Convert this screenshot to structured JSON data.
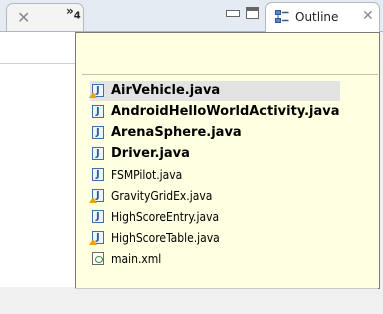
{
  "header": {
    "overflow_chevron": "»",
    "overflow_count": "4",
    "outline_tab_label": "Outline"
  },
  "popup": {
    "items": [
      {
        "label": "AirVehicle.java",
        "weight": "bold",
        "icon": "java-file-icon-warning",
        "selected": true
      },
      {
        "label": "AndroidHelloWorldActivity.java",
        "weight": "bold",
        "icon": "java-file-icon"
      },
      {
        "label": "ArenaSphere.java",
        "weight": "bold",
        "icon": "java-file-icon"
      },
      {
        "label": "Driver.java",
        "weight": "bold",
        "icon": "java-file-icon"
      },
      {
        "label": "FSMPilot.java",
        "weight": "regular",
        "icon": "java-file-icon"
      },
      {
        "label": "GravityGridEx.java",
        "weight": "regular",
        "icon": "java-file-icon-warning"
      },
      {
        "label": "HighScoreEntry.java",
        "weight": "regular",
        "icon": "java-file-icon"
      },
      {
        "label": "HighScoreTable.java",
        "weight": "regular",
        "icon": "java-file-icon-warning"
      },
      {
        "label": "main.xml",
        "weight": "regular",
        "icon": "xml-file-icon"
      }
    ]
  },
  "colors": {
    "popup_background": "#ffffe1",
    "tab_strip": "#e4ebf3",
    "selection": "#e3e3e3"
  }
}
